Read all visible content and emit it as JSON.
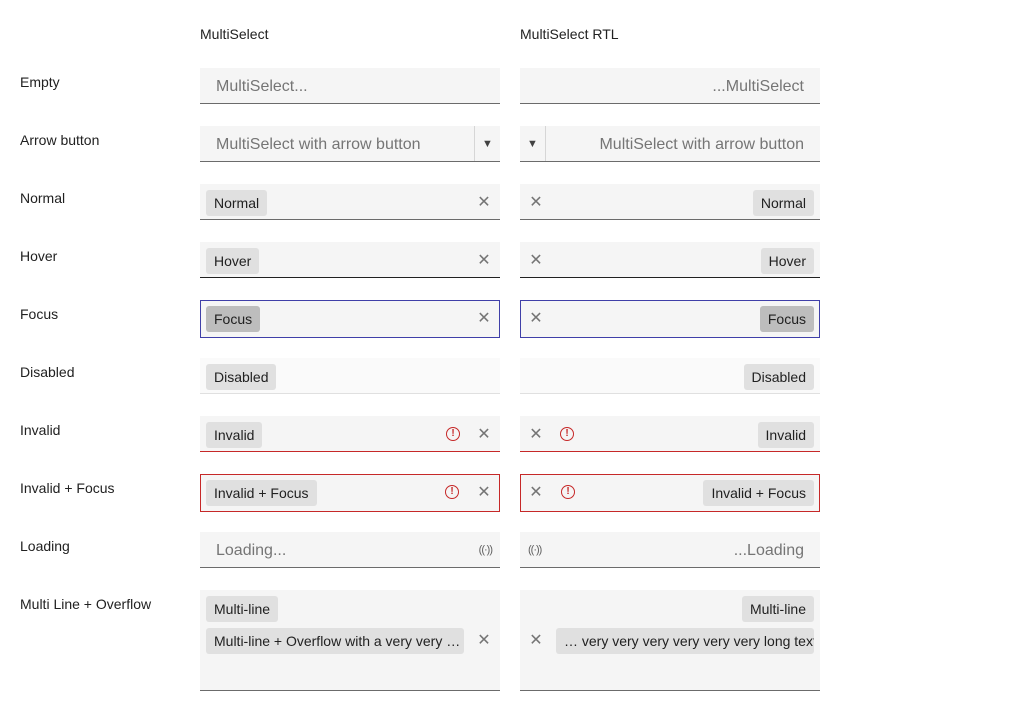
{
  "headers": {
    "ltr": "MultiSelect",
    "rtl": "MultiSelect RTL"
  },
  "rows": {
    "empty": {
      "label": "Empty",
      "placeholder_ltr": "MultiSelect...",
      "placeholder_rtl": "...MultiSelect"
    },
    "arrow": {
      "label": "Arrow button",
      "placeholder": "MultiSelect with arrow button"
    },
    "normal": {
      "label": "Normal",
      "chip": "Normal"
    },
    "hover": {
      "label": "Hover",
      "chip": "Hover"
    },
    "focus": {
      "label": "Focus",
      "chip": "Focus"
    },
    "disabled": {
      "label": "Disabled",
      "chip": "Disabled"
    },
    "invalid": {
      "label": "Invalid",
      "chip": "Invalid"
    },
    "invalid_focus": {
      "label": "Invalid + Focus",
      "chip": "Invalid + Focus"
    },
    "loading": {
      "label": "Loading",
      "placeholder_ltr": "Loading...",
      "placeholder_rtl": "...Loading"
    },
    "multiline": {
      "label": "Multi Line + Overflow",
      "chip1": "Multi-line",
      "chip2_ltr": "Multi-line + Overflow with a very very …",
      "chip2_rtl": "… very very very very very very long text"
    }
  },
  "icons": {
    "clear": "clear-icon",
    "error": "error-icon",
    "arrow": "chevron-down-icon",
    "loading": "loading-spinner-icon"
  },
  "glyphs": {
    "clear": "✕",
    "error": "!",
    "arrow": "▼",
    "loading": "((·))"
  },
  "colors": {
    "focus_border": "#3f3fa8",
    "error": "#c62828",
    "chip_bg": "#e0e0e0",
    "field_bg": "#f5f5f5"
  }
}
